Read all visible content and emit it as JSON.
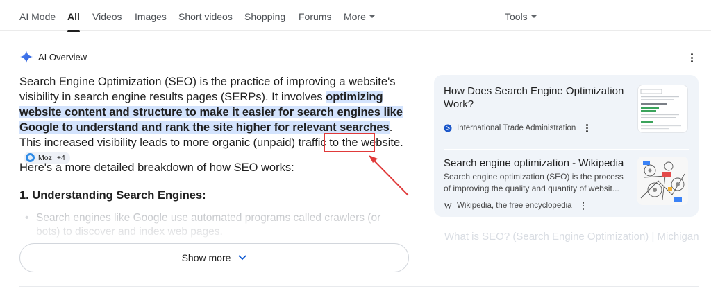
{
  "nav": {
    "tabs": [
      {
        "label": "AI Mode",
        "active": false
      },
      {
        "label": "All",
        "active": true
      },
      {
        "label": "Videos",
        "active": false
      },
      {
        "label": "Images",
        "active": false
      },
      {
        "label": "Short videos",
        "active": false
      },
      {
        "label": "Shopping",
        "active": false
      },
      {
        "label": "Forums",
        "active": false
      },
      {
        "label": "More",
        "active": false
      }
    ],
    "tools_label": "Tools"
  },
  "ai_overview": {
    "title": "AI Overview",
    "paragraph": {
      "part1": "Search Engine Optimization (SEO) is the practice of improving a website's visibility in search engine results pages (SERPs). It involves ",
      "highlight": "optimizing website content and structure to make it easier for search engines like Google to understand and rank the site higher for relevant searches",
      "part2": ". This increased visibility leads to more organic (unpaid) traffic to the website."
    },
    "citation": {
      "source": "Moz",
      "more": "+4"
    },
    "breakdown_intro": "Here's a more detailed breakdown of how SEO works:",
    "section_heading": "1. Understanding Search Engines:",
    "bullet_1": "Search engines like Google use automated programs called crawlers (or bots) to discover and index web pages.",
    "show_more_label": "Show more"
  },
  "sources": [
    {
      "title": "How Does Search Engine Optimization Work?",
      "snippet": "",
      "site": "International Trade Administration"
    },
    {
      "title": "Search engine optimization - Wikipedia",
      "snippet": "Search engine optimization (SEO) is the process of improving the quality and quantity of websit...",
      "site": "Wikipedia, the free encyclopedia"
    },
    {
      "title": "What is SEO? (Search Engine Optimization) | Michigan"
    }
  ],
  "colors": {
    "highlight": "#d3e3fd",
    "annotation": "#e03a3a",
    "panel_bg": "#f0f4f9",
    "gemini_blue": "#4f86f7"
  }
}
